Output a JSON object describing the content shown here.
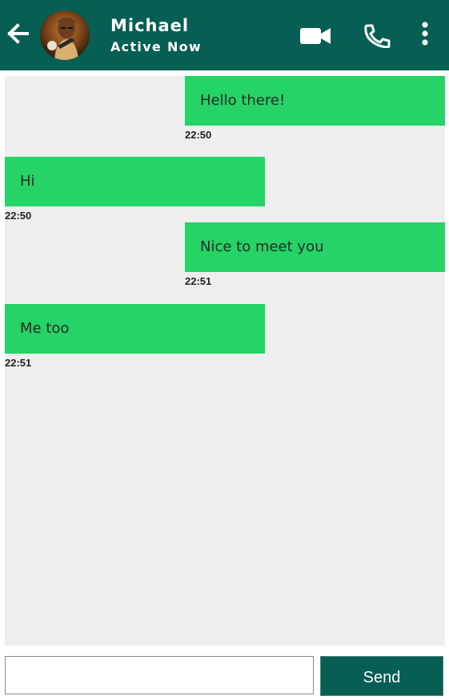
{
  "header": {
    "contact_name": "Michael",
    "status": "Active Now",
    "color": "#075e54"
  },
  "icons": {
    "back": "arrow-left-icon",
    "video": "video-camera-icon",
    "phone": "phone-icon",
    "menu": "more-vertical-icon"
  },
  "messages": [
    {
      "direction": "sent",
      "text": "Hello there!",
      "time": "22:50"
    },
    {
      "direction": "received",
      "text": "Hi",
      "time": "22:50"
    },
    {
      "direction": "sent",
      "text": "Nice to meet you",
      "time": "22:51"
    },
    {
      "direction": "received",
      "text": "Me too",
      "time": "22:51"
    }
  ],
  "composer": {
    "input_value": "",
    "send_label": "Send"
  },
  "colors": {
    "bubble": "#25d366",
    "chat_background": "#eeeeee",
    "accent": "#075e54"
  }
}
